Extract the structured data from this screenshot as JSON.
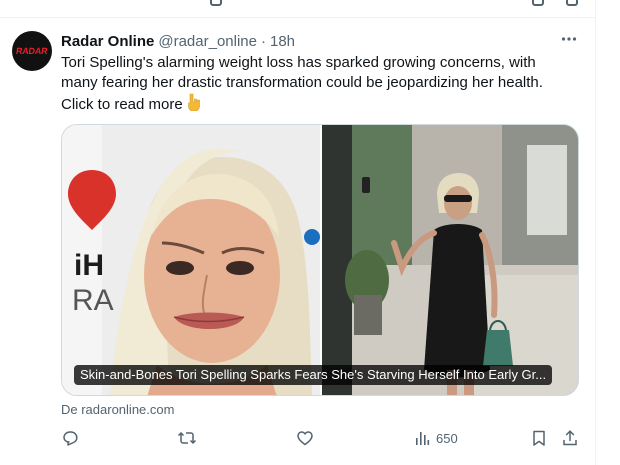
{
  "tweet": {
    "author_name": "Radar Online",
    "handle": "@radar_online",
    "separator": "·",
    "time": "18h",
    "avatar_logo": "RADAR",
    "text": "Tori Spelling's alarming weight loss has sparked growing concerns, with many fearing her drastic transformation could be jeopardizing her health. Click to read more",
    "text_emoji_icon": "pointing-down-hand-icon",
    "card_title": "Skin-and-Bones Tori Spelling Sparks Fears She's Starving Herself Into Early Gr...",
    "source": "De radaronline.com",
    "views": "650"
  },
  "icons": {
    "more": "more-dots-icon",
    "reply": "reply-icon",
    "retweet": "retweet-icon",
    "like": "like-icon",
    "views": "views-icon",
    "bookmark": "bookmark-icon",
    "share": "share-icon"
  },
  "colors": {
    "text_primary": "#0f1419",
    "text_secondary": "#536471",
    "border": "#cfd9de",
    "divider": "#eff3f4",
    "brand_red": "#e3202b"
  }
}
